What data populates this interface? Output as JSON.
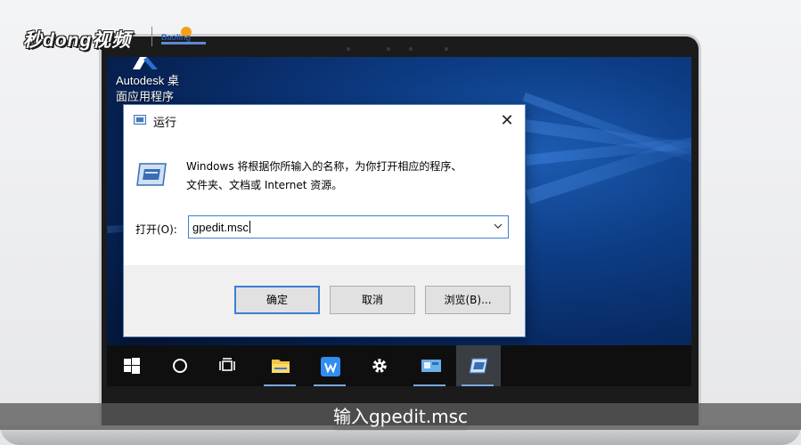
{
  "watermark": {
    "logo_text": "秒dong视频",
    "badge_text": "Baoling"
  },
  "desktop": {
    "icon_label": "Autodesk 桌\n面应用程序",
    "icon_name": "autodesk-icon"
  },
  "run_dialog": {
    "title": "运行",
    "description": "Windows 将根据你所输入的名称，为你打开相应的程序、\n文件夹、文档或 Internet 资源。",
    "open_label": "打开(O):",
    "input_value": "gpedit.msc",
    "buttons": {
      "ok": "确定",
      "cancel": "取消",
      "browse": "浏览(B)..."
    },
    "close_glyph": "✕"
  },
  "taskbar": {
    "items": [
      "start",
      "cortana",
      "task-view",
      "file-explorer",
      "wps",
      "settings",
      "control-panel",
      "run"
    ]
  },
  "subtitle": {
    "text": "输入gpedit.msc"
  },
  "colors": {
    "accent": "#3c7fd6",
    "taskbar": "#0f0f10",
    "desktop": "#0d3d86"
  }
}
